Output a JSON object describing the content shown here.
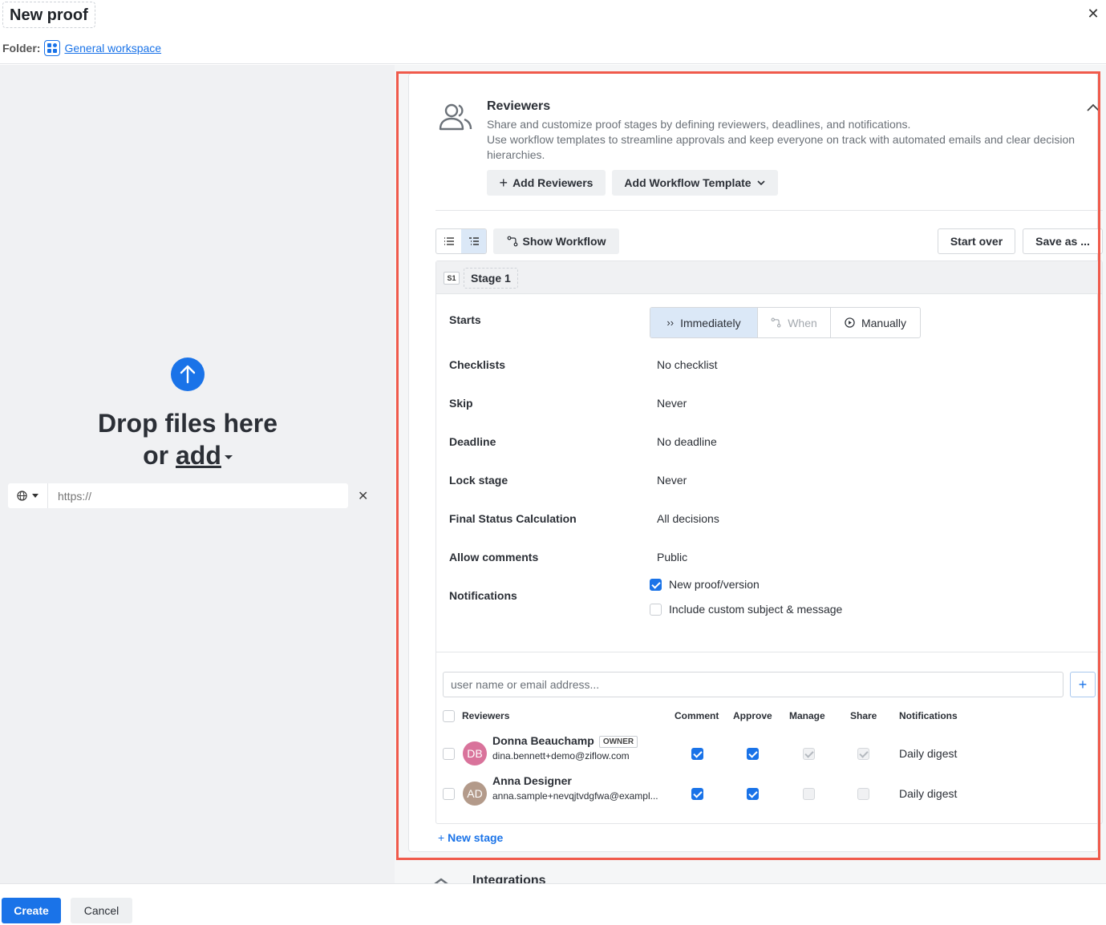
{
  "header": {
    "title": "New proof",
    "folder_label": "Folder:",
    "folder_name": "General workspace"
  },
  "upload": {
    "drop_line1": "Drop files here",
    "drop_or": "or ",
    "drop_add": "add",
    "url_placeholder": "https://"
  },
  "reviewers_section": {
    "title": "Reviewers",
    "desc_line1": "Share and customize proof stages by defining reviewers, deadlines, and notifications.",
    "desc_line2": "Use workflow templates to streamline approvals and keep everyone on track with automated emails and clear decision hierarchies.",
    "add_reviewers_label": "Add Reviewers",
    "add_template_label": "Add Workflow Template",
    "show_workflow_label": "Show Workflow",
    "start_over_label": "Start over",
    "save_as_label": "Save as ..."
  },
  "stage": {
    "badge": "S1",
    "name": "Stage 1",
    "starts_label": "Starts",
    "starts_options": [
      "Immediately",
      "When",
      "Manually"
    ],
    "starts_selected": "Immediately",
    "rows": [
      {
        "label": "Checklists",
        "value": "No checklist"
      },
      {
        "label": "Skip",
        "value": "Never"
      },
      {
        "label": "Deadline",
        "value": "No deadline"
      },
      {
        "label": "Lock stage",
        "value": "Never"
      },
      {
        "label": "Final Status Calculation",
        "value": "All decisions"
      },
      {
        "label": "Allow comments",
        "value": "Public"
      }
    ],
    "notifications_label": "Notifications",
    "notifications": [
      {
        "label": "New proof/version",
        "checked": true
      },
      {
        "label": "Include custom subject & message",
        "checked": false
      }
    ]
  },
  "reviewer_table": {
    "search_placeholder": "user name or email address...",
    "headers": [
      "Reviewers",
      "Comment",
      "Approve",
      "Manage",
      "Share",
      "Notifications"
    ],
    "rows": [
      {
        "initials": "DB",
        "avatar_color": "#d9739b",
        "name": "Donna Beauchamp",
        "badge": "OWNER",
        "email": "dina.bennett+demo@ziflow.com",
        "comment": true,
        "approve": true,
        "manage": true,
        "share": true,
        "notifications": "Daily digest"
      },
      {
        "initials": "AD",
        "avatar_color": "#b39a8a",
        "name": "Anna Designer",
        "badge": "",
        "email": "anna.sample+nevqjtvdgfwa@exampl...",
        "comment": true,
        "approve": true,
        "manage": false,
        "share": false,
        "notifications": "Daily digest"
      }
    ],
    "new_stage_label": "New stage"
  },
  "integrations": {
    "title": "Integrations"
  },
  "footer": {
    "create_label": "Create",
    "cancel_label": "Cancel"
  },
  "colors": {
    "accent": "#1a73e8",
    "highlight": "#f05a4b"
  }
}
